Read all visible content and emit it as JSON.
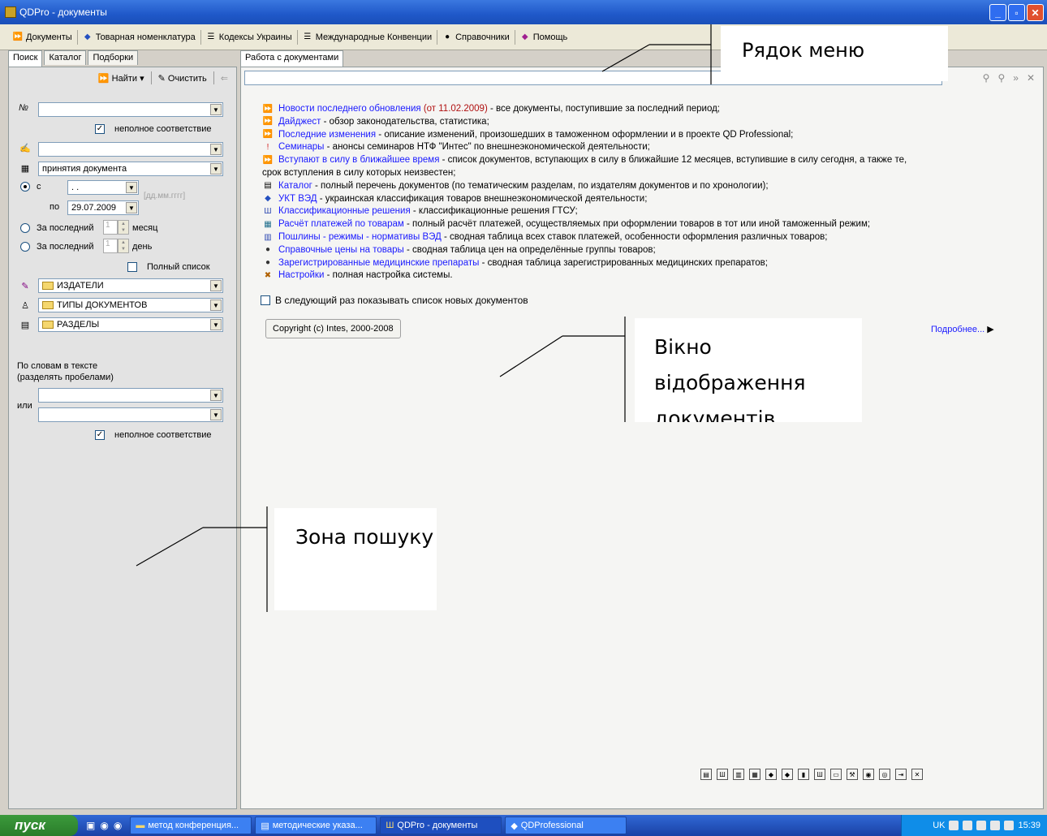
{
  "window": {
    "title": "QDPro - документы",
    "controls": [
      "_",
      "▫",
      "✕"
    ]
  },
  "menubar": {
    "items": [
      {
        "label": "Документы",
        "icon": "double-arrow-icon"
      },
      {
        "label": "Товарная номенклатура",
        "icon": "catalog-icon"
      },
      {
        "label": "Кодексы Украины",
        "icon": "document-icon"
      },
      {
        "label": "Международные Конвенции",
        "icon": "document-icon"
      },
      {
        "label": "Справочники",
        "icon": "info-icon"
      },
      {
        "label": "Помощь",
        "icon": "help-icon"
      }
    ]
  },
  "left_tabs": [
    "Поиск",
    "Каталог",
    "Подборки"
  ],
  "right_tabs": [
    "Работа с документами"
  ],
  "search": {
    "find_label": "Найти",
    "clear_label": "Очистить",
    "number_label": "№",
    "partial_match_label": "неполное соответствие",
    "date_type_value": "принятия документа",
    "from_label": "с",
    "from_value": ". .",
    "to_label": "по",
    "to_value": "29.07.2009",
    "date_hint": "[дд.мм.гггг]",
    "last_label_1": "За последний",
    "last_value_1": "1",
    "month_label": "месяц",
    "last_label_2": "За последний",
    "last_value_2": "1",
    "day_label": "день",
    "full_list_label": "Полный список",
    "publishers_value": "ИЗДАТЕЛИ",
    "doc_types_value": "ТИПЫ ДОКУМЕНТОВ",
    "sections_value": "РАЗДЕЛЫ",
    "words_label_1": "По словам в тексте",
    "words_label_2": "(разделять пробелами)",
    "or_label": "или",
    "partial_match_label_2": "неполное соответствие"
  },
  "doclist": [
    {
      "icon": "double-arrow-icon",
      "link": "Новости последнего обновления",
      "extra": " (от 11.02.2009)",
      "text": " - все документы, поступившие за последний период;"
    },
    {
      "icon": "double-arrow-icon",
      "link": "Дайджест",
      "text": " - обзор законодательства, статистика;"
    },
    {
      "icon": "double-arrow-icon",
      "link": "Последние изменения",
      "text": " - описание изменений, произошедших в таможенном оформлении и в проекте QD Professional;"
    },
    {
      "icon": "seminar-icon",
      "link": "Семинары",
      "text": " - анонсы семинаров НТФ \"Интес\" по внешнеэкономической деятельности;"
    },
    {
      "icon": "double-arrow-icon",
      "link": "Вступают в силу в ближайшее время",
      "text": " - список документов, вступающих в силу в ближайшие 12 месяцев, вступившие в силу сегодня, а также те,"
    },
    {
      "icon": "",
      "link": "",
      "text": "срок вступления в силу которых неизвестен;"
    },
    {
      "icon": "catalog-icon",
      "link": "Каталог",
      "text": " - полный перечень документов (по тематическим разделам, по издателям документов и по хронологии);"
    },
    {
      "icon": "ukt-icon",
      "link": "УКТ ВЭД",
      "text": " - украинская классификация товаров внешнеэкономической деятельности;"
    },
    {
      "icon": "trident-icon",
      "link": "Классификационные решения",
      "text": " - классификационные решения ГТСУ;"
    },
    {
      "icon": "calculator-icon",
      "link": "Расчёт платежей по товарам",
      "text": " - полный расчёт платежей, осуществляемых при оформлении товаров в тот или иной таможенный режим;"
    },
    {
      "icon": "chart-icon",
      "link": "Пошлины - режимы - нормативы ВЭД",
      "text": " - сводная таблица всех ставок платежей, особенности оформления различных товаров;"
    },
    {
      "icon": "info-icon",
      "link": "Справочные цены на товары",
      "text": " - сводная таблица цен на определённые группы товаров;"
    },
    {
      "icon": "info-icon",
      "link": "Зарегистрированные медицинские препараты",
      "text": " - сводная таблица зарегистрированных медицинских препаратов;"
    },
    {
      "icon": "settings-icon",
      "link": "Настройки",
      "text": " - полная настройка системы."
    }
  ],
  "show_next_label": "В следующий раз показывать список новых документов",
  "copyright": "Copyright (c) Intes, 2000-2008",
  "more_link": "Подробнее...",
  "annotations": {
    "menu_row": "Рядок меню",
    "doc_window": "Вікно відображення документів",
    "search_zone": "Зона пошуку"
  },
  "taskbar": {
    "start": "пуск",
    "tasks": [
      "метод конференция...",
      "методические указа...",
      "QDPro - документы",
      "QDProfessional"
    ],
    "lang": "UK",
    "clock": "15:39"
  }
}
